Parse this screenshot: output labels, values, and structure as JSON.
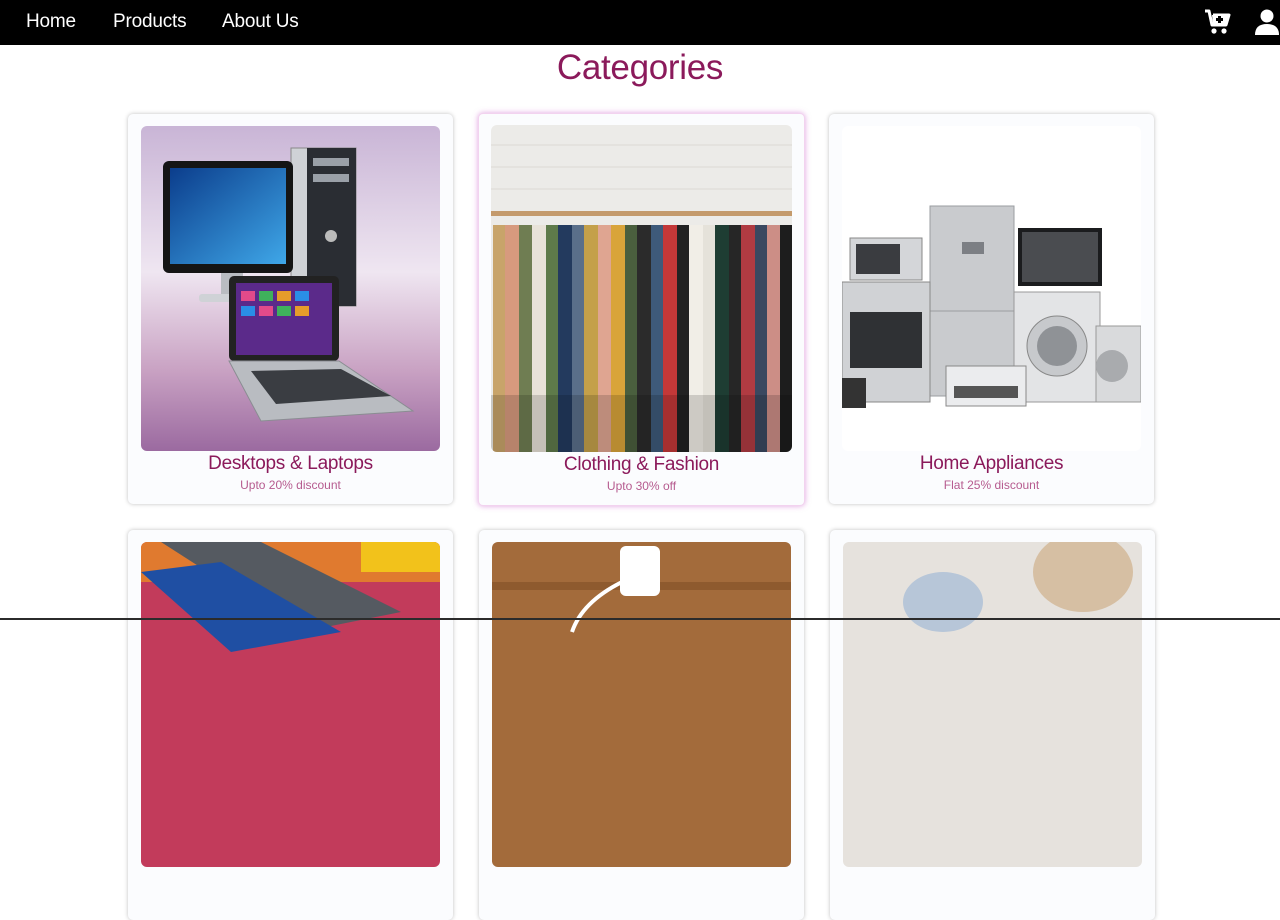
{
  "nav": {
    "links": [
      "Home",
      "Products",
      "About Us"
    ],
    "icons": [
      "cart-plus-icon",
      "user-icon"
    ]
  },
  "page": {
    "title": "Categories"
  },
  "categories": [
    {
      "title": "Desktops & Laptops",
      "subtitle": "Upto 20% discount",
      "image": "desktop-laptop-image"
    },
    {
      "title": "Clothing & Fashion",
      "subtitle": "Upto 30% off",
      "image": "clothing-rack-image"
    },
    {
      "title": "Home Appliances",
      "subtitle": "Flat 25% discount",
      "image": "home-appliances-image"
    },
    {
      "title": "",
      "subtitle": "",
      "image": "smartphones-image"
    },
    {
      "title": "",
      "subtitle": "",
      "image": "charger-accessories-image"
    },
    {
      "title": "",
      "subtitle": "",
      "image": "toys-image"
    }
  ],
  "colors": {
    "navbar": "#000000",
    "accent": "#8b1a5b",
    "subtext": "#b65b8f"
  }
}
